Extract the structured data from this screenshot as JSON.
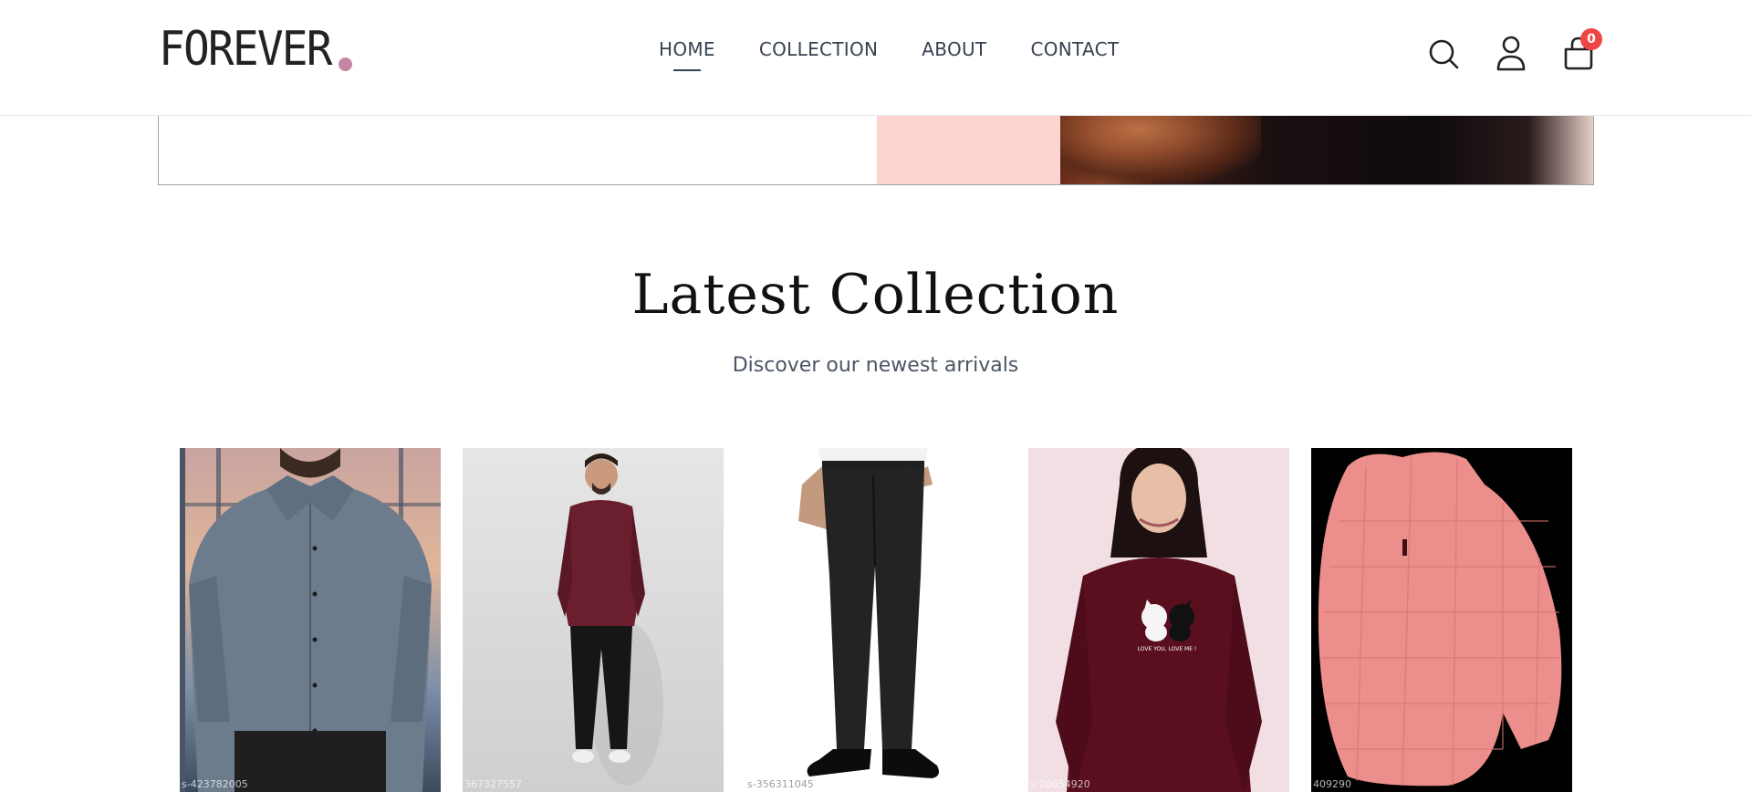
{
  "header": {
    "logo_text": "FOREVER",
    "logo_dot_color": "#c586a5",
    "nav": [
      {
        "label": "HOME",
        "active": true
      },
      {
        "label": "COLLECTION",
        "active": false
      },
      {
        "label": "ABOUT",
        "active": false
      },
      {
        "label": "CONTACT",
        "active": false
      }
    ],
    "icons": [
      "search-icon",
      "user-icon",
      "cart-icon"
    ],
    "cart_count": "0"
  },
  "section": {
    "title": "Latest Collection",
    "subtitle": "Discover our newest arrivals"
  },
  "products": [
    {
      "image": "men-grey-formal-shirt",
      "watermark": "s-423782005"
    },
    {
      "image": "men-maroon-tshirt-black-jeans",
      "watermark": "367327557"
    },
    {
      "image": "men-black-formal-trousers",
      "watermark": "s-356311045"
    },
    {
      "image": "women-maroon-cat-sweatshirt",
      "watermark": "s-20654920"
    },
    {
      "image": "pink-checked-hoodie",
      "watermark": "409290"
    }
  ],
  "colors": {
    "cart_badge": "#ef4444",
    "hero_pink": "#fdd4d2",
    "text_dark": "#374151"
  }
}
